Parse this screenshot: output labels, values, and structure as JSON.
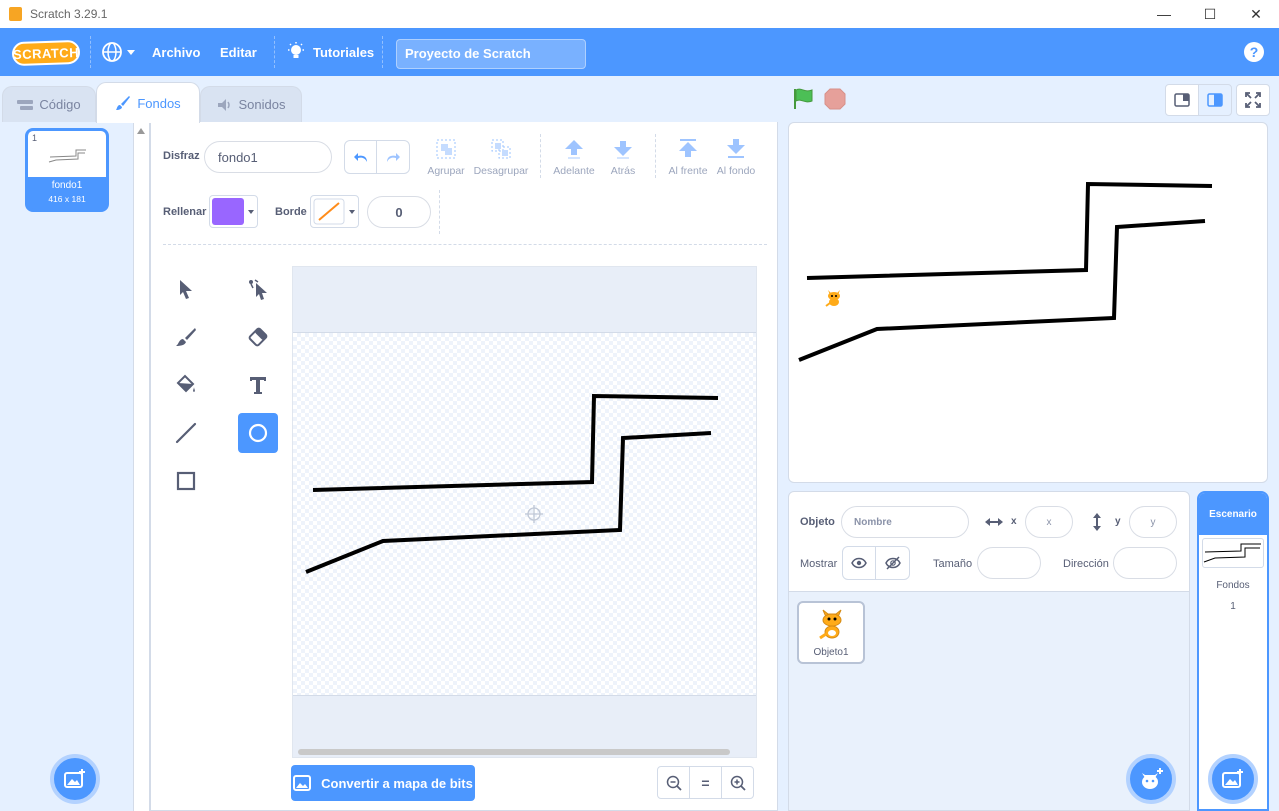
{
  "window": {
    "title": "Scratch 3.29.1",
    "minimize": "—",
    "maximize": "☐",
    "close": "✕"
  },
  "menubar": {
    "logo": "SCRATCH",
    "file": "Archivo",
    "edit": "Editar",
    "tutorials": "Tutoriales",
    "project_title": "Proyecto de Scratch",
    "help": "?"
  },
  "tabs": {
    "code": "Código",
    "costumes": "Fondos",
    "sounds": "Sonidos"
  },
  "costume_list": {
    "items": [
      {
        "index": "1",
        "name": "fondo1",
        "size": "416 x 181"
      }
    ]
  },
  "paint": {
    "costume_label": "Disfraz",
    "costume_name": "fondo1",
    "group": "Agrupar",
    "ungroup": "Desagrupar",
    "forward": "Adelante",
    "backward": "Atrás",
    "front": "Al frente",
    "back": "Al fondo",
    "fill_label": "Rellenar",
    "outline_label": "Borde",
    "outline_width": "0",
    "fill_color": "#9966ff",
    "convert_button": "Convertir a mapa de bits",
    "zoom_reset": "="
  },
  "sprite_info": {
    "sprite_label": "Objeto",
    "name_placeholder": "Nombre",
    "x_label": "x",
    "x_placeholder": "x",
    "y_label": "y",
    "y_placeholder": "y",
    "show_label": "Mostrar",
    "size_label": "Tamaño",
    "direction_label": "Dirección"
  },
  "sprites": [
    {
      "name": "Objeto1"
    }
  ],
  "stage_target": {
    "header": "Escenario",
    "backdrops_label": "Fondos",
    "backdrops_count": "1"
  },
  "colors": {
    "accent": "#4c97ff",
    "green_flag": "#4cbf56",
    "stop": "#ec5959"
  }
}
